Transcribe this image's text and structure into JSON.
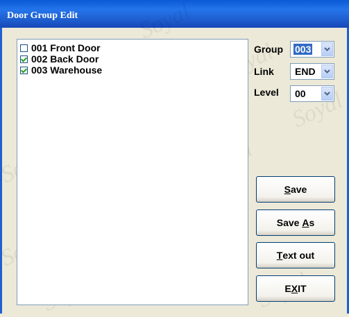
{
  "window": {
    "title": "Door Group Edit"
  },
  "doors": [
    {
      "label": "001 Front Door",
      "checked": false
    },
    {
      "label": "002 Back Door",
      "checked": true
    },
    {
      "label": "003 Warehouse",
      "checked": true
    }
  ],
  "fields": {
    "group": {
      "label": "Group",
      "value": "003"
    },
    "link": {
      "label": "Link",
      "value": "END"
    },
    "level": {
      "label": "Level",
      "value": "00"
    }
  },
  "buttons": {
    "save": {
      "before": "",
      "mnemonic": "S",
      "after": "ave"
    },
    "save_as": {
      "before": "Save ",
      "mnemonic": "A",
      "after": "s"
    },
    "text_out": {
      "before": "",
      "mnemonic": "T",
      "after": "ext out"
    },
    "exit": {
      "before": "E",
      "mnemonic": "X",
      "after": "IT"
    }
  },
  "watermark": "Soyal",
  "colors": {
    "titlebar": "#0a5ad7",
    "window_bg": "#ece9d8",
    "check": "#21a121",
    "selection": "#316ac5"
  }
}
